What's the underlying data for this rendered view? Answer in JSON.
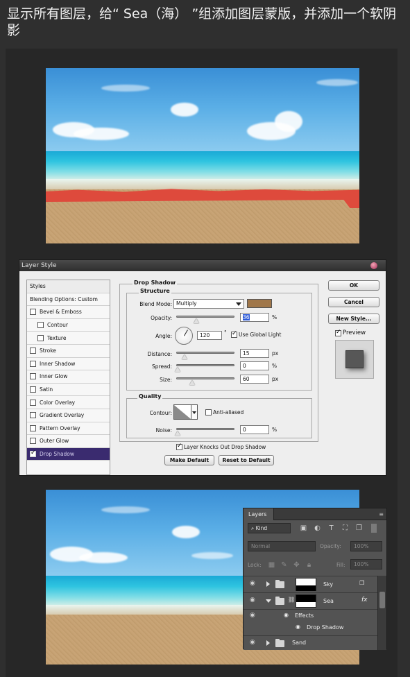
{
  "instruction": "显示所有图层，给“ Sea（海） ”组添加图层蒙版，并添加一个软阴影",
  "dialog": {
    "title": "Layer Style",
    "styles_header": "Styles",
    "blending_options": "Blending Options: Custom",
    "styles": [
      {
        "label": "Bevel & Emboss",
        "checked": false,
        "indent": false
      },
      {
        "label": "Contour",
        "checked": false,
        "indent": true
      },
      {
        "label": "Texture",
        "checked": false,
        "indent": true
      },
      {
        "label": "Stroke",
        "checked": false,
        "indent": false
      },
      {
        "label": "Inner Shadow",
        "checked": false,
        "indent": false
      },
      {
        "label": "Inner Glow",
        "checked": false,
        "indent": false
      },
      {
        "label": "Satin",
        "checked": false,
        "indent": false
      },
      {
        "label": "Color Overlay",
        "checked": false,
        "indent": false
      },
      {
        "label": "Gradient Overlay",
        "checked": false,
        "indent": false
      },
      {
        "label": "Pattern Overlay",
        "checked": false,
        "indent": false
      },
      {
        "label": "Outer Glow",
        "checked": false,
        "indent": false
      },
      {
        "label": "Drop Shadow",
        "checked": true,
        "indent": false,
        "selected": true
      }
    ],
    "section_title": "Drop Shadow",
    "structure": "Structure",
    "blend_mode_label": "Blend Mode:",
    "blend_mode_value": "Multiply",
    "shadow_color": "#a0774a",
    "opacity_label": "Opacity:",
    "opacity_value": "36",
    "angle_label": "Angle:",
    "angle_value": "120",
    "angle_unit": "°",
    "use_global_light": "Use Global Light",
    "distance_label": "Distance:",
    "distance_value": "15",
    "spread_label": "Spread:",
    "spread_value": "0",
    "size_label": "Size:",
    "size_value": "60",
    "unit_px": "px",
    "unit_pct": "%",
    "quality": "Quality",
    "contour_label": "Contour:",
    "anti_aliased": "Anti-aliased",
    "noise_label": "Noise:",
    "noise_value": "0",
    "knocks_out": "Layer Knocks Out Drop Shadow",
    "make_default": "Make Default",
    "reset_default": "Reset to Default",
    "ok": "OK",
    "cancel": "Cancel",
    "new_style": "New Style...",
    "preview": "Preview"
  },
  "layers_panel": {
    "tab": "Layers",
    "menu_icon": "≡",
    "filter_kind": "Kind",
    "blend_mode": "Normal",
    "opacity_label": "Opacity:",
    "opacity_value": "100%",
    "lock_label": "Lock:",
    "fill_label": "Fill:",
    "fill_value": "100%",
    "layers": [
      {
        "name": "Sky"
      },
      {
        "name": "Sea",
        "fx": "fx"
      },
      {
        "name": "Effects"
      },
      {
        "name": "Drop Shadow"
      },
      {
        "name": "Sand"
      }
    ]
  }
}
